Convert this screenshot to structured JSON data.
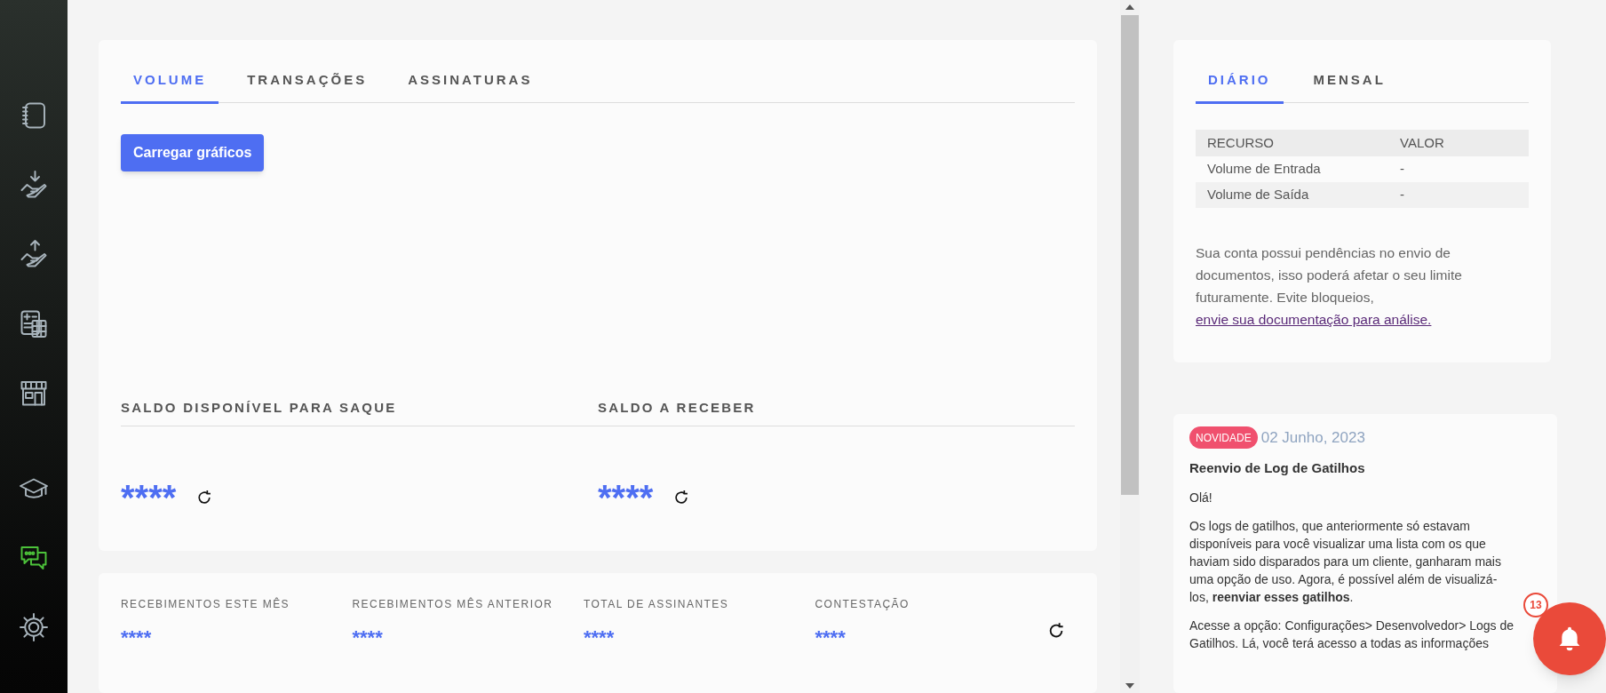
{
  "sidebar": {
    "items": [
      {
        "kind": "notebook",
        "selected": false
      },
      {
        "kind": "receive",
        "selected": false
      },
      {
        "kind": "send",
        "selected": false
      },
      {
        "kind": "calculator",
        "selected": false
      },
      {
        "kind": "store",
        "selected": false
      },
      {
        "kind": "graduation",
        "selected": false
      },
      {
        "kind": "chat",
        "selected": true
      },
      {
        "kind": "settings",
        "selected": false
      }
    ]
  },
  "main_card": {
    "tabs": [
      {
        "label": "VOLUME",
        "selected": true
      },
      {
        "label": "TRANSAÇÕES",
        "selected": false
      },
      {
        "label": "ASSINATURAS",
        "selected": false
      }
    ],
    "load_button": "Carregar gráficos",
    "balances": [
      {
        "label": "SALDO DISPONÍVEL PARA SAQUE",
        "value": "****"
      },
      {
        "label": "SALDO A RECEBER",
        "value": "****"
      }
    ]
  },
  "stats_card": {
    "stats": [
      {
        "label": "RECEBIMENTOS ESTE MÊS",
        "value": "****"
      },
      {
        "label": "RECEBIMENTOS MÊS ANTERIOR",
        "value": "****"
      },
      {
        "label": "TOTAL DE ASSINANTES",
        "value": "****"
      },
      {
        "label": "CONTESTAÇÃO",
        "value": "****"
      }
    ]
  },
  "limits_card": {
    "tabs": [
      {
        "label": "DIÁRIO",
        "selected": true
      },
      {
        "label": "MENSAL",
        "selected": false
      }
    ],
    "table": {
      "columns": [
        "RECURSO",
        "VALOR"
      ],
      "rows": [
        [
          "Volume de Entrada",
          "-"
        ],
        [
          "Volume de Saída",
          "-"
        ]
      ]
    },
    "notice": "Sua conta possui pendências no envio de documentos, isso poderá afetar o seu limite futuramente. Evite bloqueios, ",
    "notice_link": "envie sua documentação para análise."
  },
  "news_card": {
    "badge": "NOVIDADE",
    "date": "02 Junho, 2023",
    "title": "Reenvio de Log de Gatilhos",
    "paragraphs": [
      "Olá!",
      "Os logs de gatilhos, que anteriormente só estavam disponíveis para você visualizar uma lista com os que haviam sido disparados para um cliente, ganharam mais uma opção de uso.  Agora, é possível além de visualizá-los, **reenviar esses gatilhos**.",
      "Acesse a opção: Configurações> Desenvolvedor> Logs de Gatilhos. Lá, você terá acesso a todas as informações"
    ]
  },
  "notifications": {
    "count": "13"
  }
}
